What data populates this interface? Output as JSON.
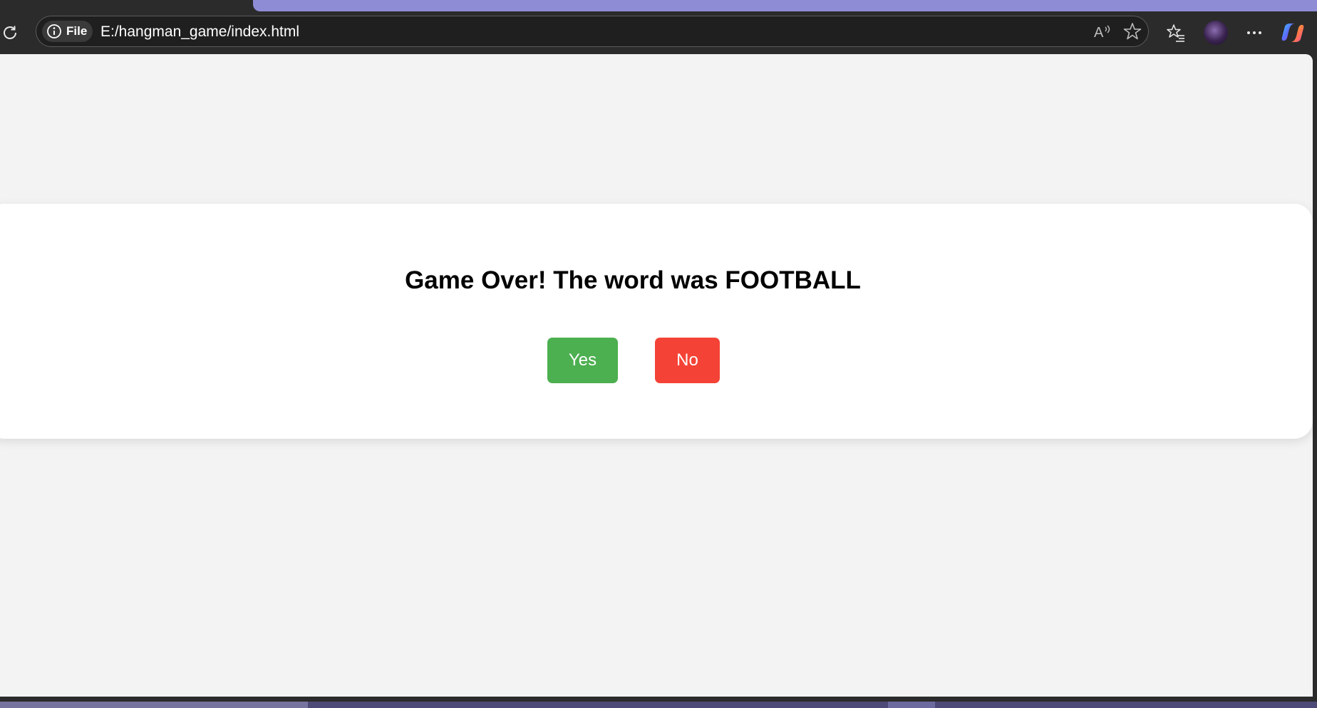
{
  "browser": {
    "site_info_label": "File",
    "url": "E:/hangman_game/index.html",
    "icons": {
      "reload": "reload-icon",
      "info": "info-icon",
      "read_aloud": "read-aloud-icon",
      "favorite": "star-icon",
      "favorites_list": "favorites-icon",
      "profile": "avatar",
      "more": "more-icon",
      "copilot": "copilot-icon"
    },
    "colors": {
      "tab_accent": "#8f8cd6",
      "toolbar_bg": "#2b2b2b"
    }
  },
  "modal": {
    "message": "Game Over! The word was FOOTBALL",
    "yes_label": "Yes",
    "no_label": "No",
    "colors": {
      "yes": "#4caf50",
      "no": "#f44336"
    }
  }
}
